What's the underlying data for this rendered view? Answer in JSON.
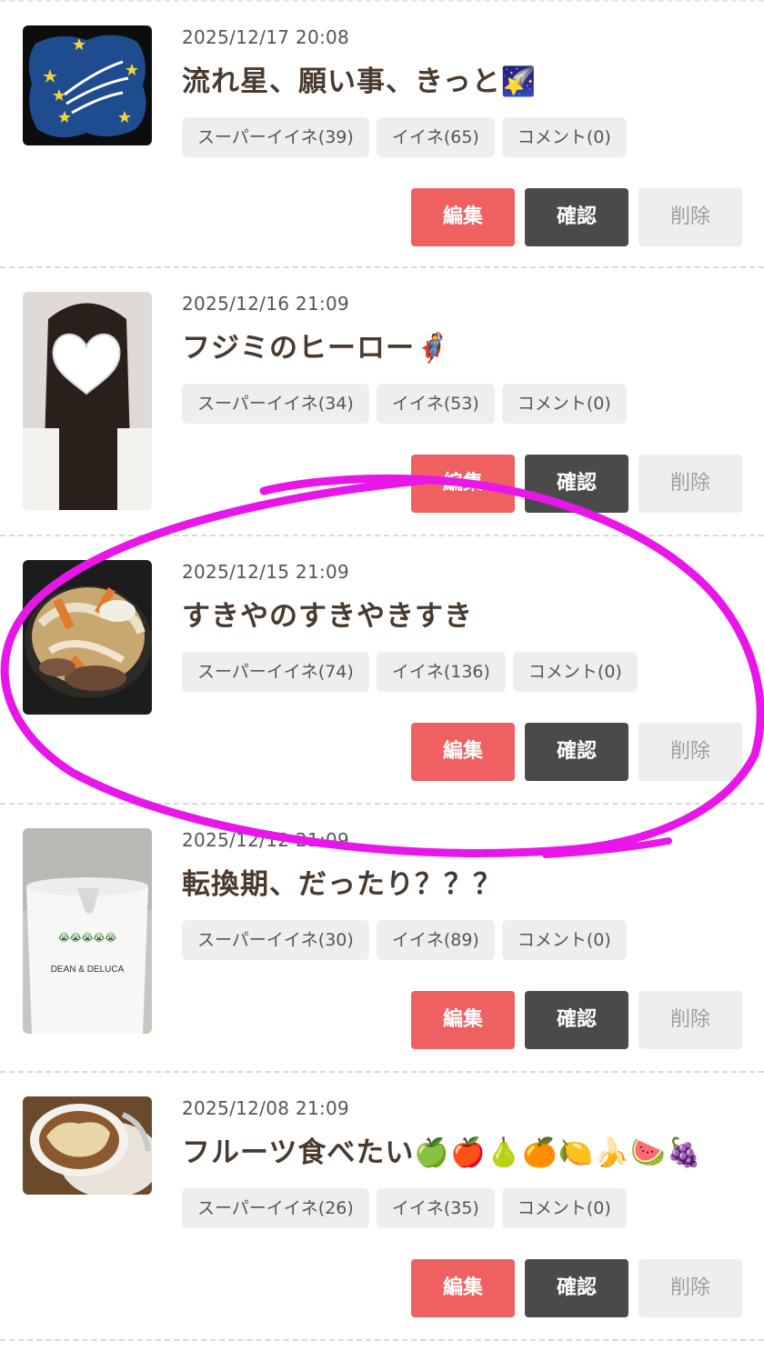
{
  "labels": {
    "edit": "編集",
    "confirm": "確認",
    "delete": "削除"
  },
  "posts": [
    {
      "date": "2025/12/17 20:08",
      "title": "流れ星、願い事、きっと🌠",
      "thumbnail": "shooting-stars-illustration",
      "tags": [
        "スーパーイイネ(39)",
        "イイネ(65)",
        "コメント(0)"
      ]
    },
    {
      "date": "2025/12/16 21:09",
      "title": "フジミのヒーロー🦸",
      "thumbnail": "long-hair-selfie-with-heart",
      "tags": [
        "スーパーイイネ(34)",
        "イイネ(53)",
        "コメント(0)"
      ]
    },
    {
      "date": "2025/12/15 21:09",
      "title": "すきやのすきやきすき",
      "thumbnail": "sukiyaki-photo",
      "tags": [
        "スーパーイイネ(74)",
        "イイネ(136)",
        "コメント(0)"
      ]
    },
    {
      "date": "2025/12/12 21:09",
      "title": "転換期、だったり？？？",
      "thumbnail": "mug-photo",
      "thumbnail_text": "DEAN & DELUCA",
      "tags": [
        "スーパーイイネ(30)",
        "イイネ(89)",
        "コメント(0)"
      ]
    },
    {
      "date": "2025/12/08 21:09",
      "title": "フルーツ食べたい🍏🍎🍐🍊🍋🍌🍉🍇",
      "thumbnail": "coffee-cup-photo",
      "tags": [
        "スーパーイイネ(26)",
        "イイネ(35)",
        "コメント(0)"
      ]
    }
  ],
  "colors": {
    "edit": "#ef6161",
    "confirm": "#4a4a4a",
    "delete_bg": "#eeeeee",
    "annotation": "#e816e8"
  }
}
